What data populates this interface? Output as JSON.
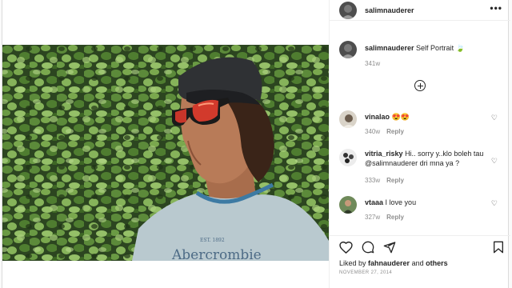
{
  "post": {
    "username": "salimnauderer",
    "more_icon": "more-horizontal-icon",
    "caption": "Self Portrait",
    "caption_emoji": "🍃",
    "caption_time": "341w",
    "shirt_brand": "Abercrombie",
    "shirt_est": "EST. 1892"
  },
  "comments": [
    {
      "user": "vinalao",
      "text": "😍😍",
      "time": "340w",
      "reply_label": "Reply"
    },
    {
      "user": "vitria_risky",
      "text": "Hi.. sorry y..klo boleh tau @salimnauderer dri mna ya ?",
      "time": "333w",
      "reply_label": "Reply"
    },
    {
      "user": "vtaaa",
      "text": "I love you",
      "time": "327w",
      "reply_label": "Reply"
    }
  ],
  "likes": {
    "prefix": "Liked by",
    "user": "fahnauderer",
    "joiner": "and",
    "others": "others"
  },
  "date": "NOVEMBER 27, 2014",
  "icons": [
    "heart-icon",
    "comment-icon",
    "share-icon",
    "bookmark-icon",
    "load-more-plus-icon"
  ]
}
